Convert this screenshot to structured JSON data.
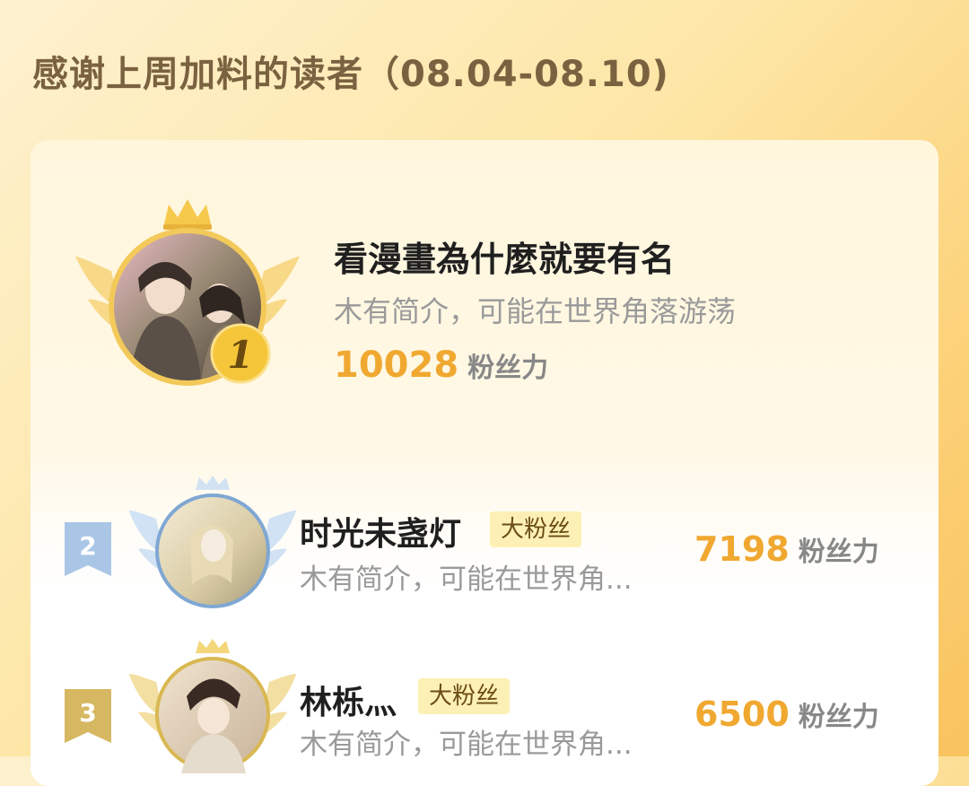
{
  "header": {
    "title": "感谢上周加料的读者（08.04-08.10)"
  },
  "colors": {
    "gold": "#f0a830",
    "silver": "#8fb4dc",
    "bronze": "#c9a54a",
    "tag_bg": "#fdf0b4"
  },
  "leaderboard": {
    "first": {
      "rank": "1",
      "name": "看漫畫為什麼就要有名",
      "desc": "木有简介，可能在世界角落游荡",
      "score": "10028",
      "score_unit": "粉丝力"
    },
    "second": {
      "rank": "2",
      "name": "时光未盏灯",
      "tag": "大粉丝",
      "desc": "木有简介，可能在世界角...",
      "score": "7198",
      "score_unit": "粉丝力"
    },
    "third": {
      "rank": "3",
      "name": "林栎灬",
      "tag": "大粉丝",
      "desc": "木有简介，可能在世界角...",
      "score": "6500",
      "score_unit": "粉丝力"
    }
  }
}
